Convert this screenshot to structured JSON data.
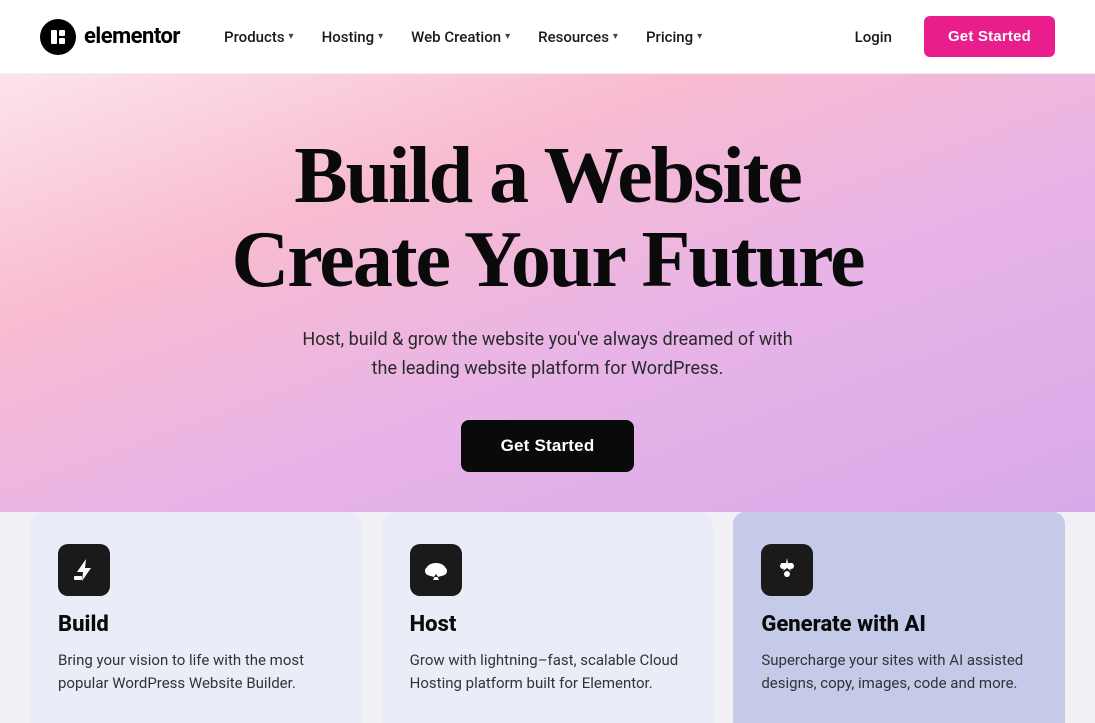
{
  "logo": {
    "icon_symbol": "e",
    "text": "elementor"
  },
  "nav": {
    "items": [
      {
        "label": "Products",
        "has_dropdown": true
      },
      {
        "label": "Hosting",
        "has_dropdown": true
      },
      {
        "label": "Web Creation",
        "has_dropdown": true
      },
      {
        "label": "Resources",
        "has_dropdown": true
      },
      {
        "label": "Pricing",
        "has_dropdown": true
      }
    ],
    "login_label": "Login",
    "get_started_label": "Get Started"
  },
  "hero": {
    "title_line1": "Build a Website",
    "title_line2": "Create Your Future",
    "subtitle": "Host, build & grow the website you've always dreamed of with the leading website platform for WordPress.",
    "cta_label": "Get Started"
  },
  "cards": [
    {
      "id": "build",
      "title": "Build",
      "description": "Bring your vision to life with the most popular WordPress Website Builder.",
      "icon": "build"
    },
    {
      "id": "host",
      "title": "Host",
      "description": "Grow with lightning–fast, scalable Cloud Hosting platform built for Elementor.",
      "icon": "cloud"
    },
    {
      "id": "ai",
      "title": "Generate with AI",
      "description": "Supercharge your sites with AI assisted designs, copy, images, code and more.",
      "icon": "ai"
    }
  ],
  "colors": {
    "brand_pink": "#e91e8c",
    "hero_bg_start": "#fce4ec",
    "hero_bg_end": "#d8a8e8",
    "card_ai_bg": "#c5cae9"
  }
}
